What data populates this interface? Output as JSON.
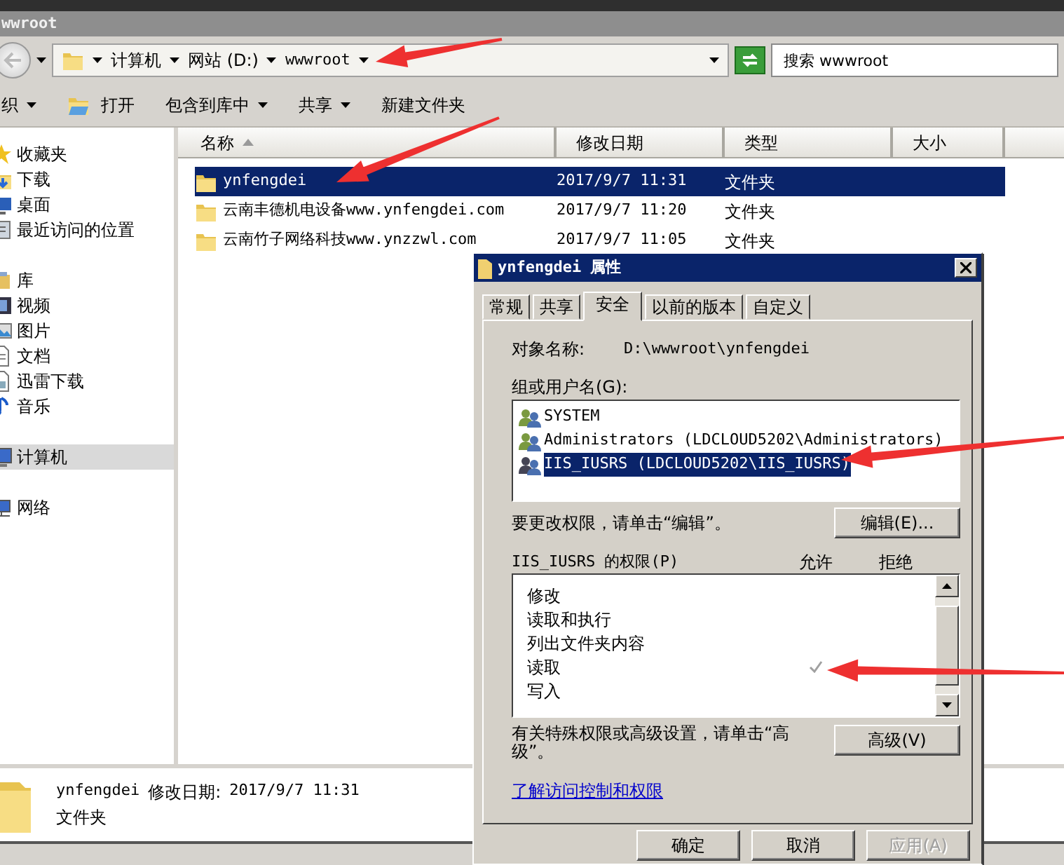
{
  "window": {
    "title": "wwroot"
  },
  "address": {
    "crumbs": [
      "计算机",
      "网站 (D:)",
      "wwwroot"
    ]
  },
  "search": {
    "placeholder": "搜索 wwwroot"
  },
  "toolbar": [
    {
      "label": "织",
      "kind": "menu"
    },
    {
      "label": "打开",
      "kind": "icon-button"
    },
    {
      "label": "包含到库中",
      "kind": "menu"
    },
    {
      "label": "共享",
      "kind": "menu"
    },
    {
      "label": "新建文件夹",
      "kind": "button"
    }
  ],
  "sidebar": {
    "groups": [
      {
        "items": [
          {
            "label": "收藏夹",
            "selected": false
          },
          {
            "label": "下载",
            "selected": false
          },
          {
            "label": "桌面",
            "selected": false
          },
          {
            "label": "最近访问的位置",
            "selected": false
          }
        ]
      },
      {
        "items": [
          {
            "label": "库",
            "selected": false
          },
          {
            "label": "视频",
            "selected": false
          },
          {
            "label": "图片",
            "selected": false
          },
          {
            "label": "文档",
            "selected": false
          },
          {
            "label": "迅雷下载",
            "selected": false
          },
          {
            "label": "音乐",
            "selected": false
          }
        ]
      },
      {
        "items": [
          {
            "label": "计算机",
            "selected": true
          }
        ]
      },
      {
        "items": [
          {
            "label": "网络",
            "selected": false
          }
        ]
      }
    ]
  },
  "file_list": {
    "columns": [
      {
        "label": "名称",
        "sorted": true
      },
      {
        "label": "修改日期",
        "sorted": false
      },
      {
        "label": "类型",
        "sorted": false
      },
      {
        "label": "大小",
        "sorted": false
      }
    ],
    "rows": [
      {
        "cells": [
          "ynfengdei",
          "2017/9/7 11:31",
          "文件夹"
        ],
        "selected": true
      },
      {
        "cells": [
          "云南丰德机电设备www.ynfengdei.com",
          "2017/9/7 11:20",
          "文件夹"
        ],
        "selected": false
      },
      {
        "cells": [
          "云南竹子网络科技www.ynzzwl.com",
          "2017/9/7 11:05",
          "文件夹"
        ],
        "selected": false
      }
    ]
  },
  "details": {
    "name": "ynfengdei",
    "modified_label": "修改日期:",
    "modified": "2017/9/7 11:31",
    "type": "文件夹"
  },
  "dialog": {
    "title": "ynfengdei 属性",
    "tabs": [
      {
        "label": "常规",
        "selected": false
      },
      {
        "label": "共享",
        "selected": false
      },
      {
        "label": "安全",
        "selected": true
      },
      {
        "label": "以前的版本",
        "selected": false
      },
      {
        "label": "自定义",
        "selected": false
      }
    ],
    "object_label": "对象名称:",
    "object_value": "D:\\wwwroot\\ynfengdei",
    "users_label": "组或用户名(G):",
    "users": [
      {
        "name": "SYSTEM",
        "selected": false
      },
      {
        "name": "Administrators (LDCLOUD5202\\Administrators)",
        "selected": false
      },
      {
        "name": "IIS_IUSRS (LDCLOUD5202\\IIS_IUSRS)",
        "selected": true
      }
    ],
    "edit_hint": "要更改权限，请单击“编辑”。",
    "edit_button": "编辑(E)...",
    "permissions_label": "IIS_IUSRS 的权限(P)",
    "allow_label": "允许",
    "deny_label": "拒绝",
    "permissions": [
      {
        "name": "修改",
        "allow": false,
        "deny": false
      },
      {
        "name": "读取和执行",
        "allow": false,
        "deny": false
      },
      {
        "name": "列出文件夹内容",
        "allow": false,
        "deny": false
      },
      {
        "name": "读取",
        "allow": true,
        "deny": false
      },
      {
        "name": "写入",
        "allow": false,
        "deny": false
      }
    ],
    "advanced_hint": "有关特殊权限或高级设置，请单击“高级”。",
    "advanced_button": "高级(V)",
    "link": "了解访问控制和权限",
    "buttons": [
      {
        "label": "确定",
        "disabled": false
      },
      {
        "label": "取消",
        "disabled": false
      },
      {
        "label": "应用(A)",
        "disabled": true
      }
    ]
  }
}
